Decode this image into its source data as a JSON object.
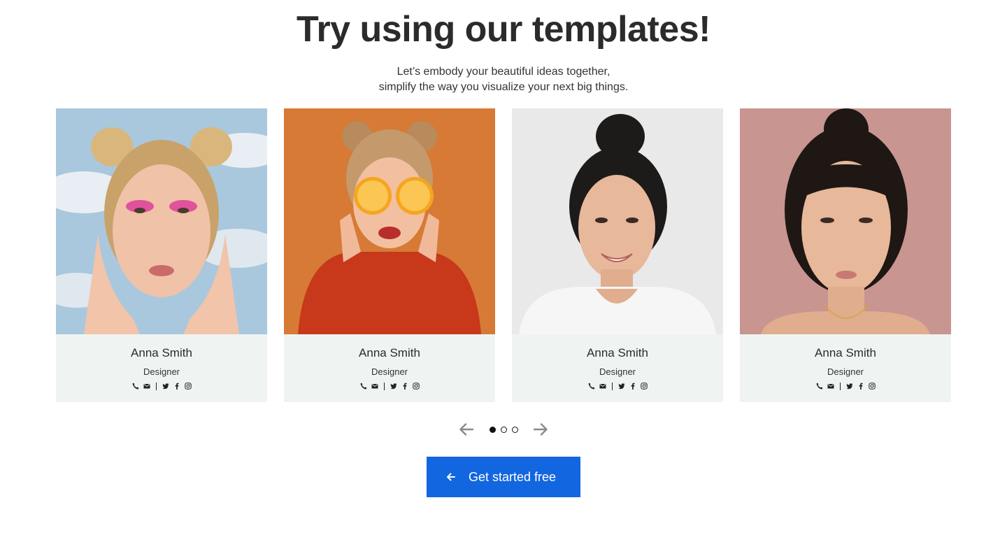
{
  "hero": {
    "title": "Try using our templates!",
    "subtitle_line1": "Let’s embody your beautiful ideas together,",
    "subtitle_line2": "simplify the way you visualize your next big things."
  },
  "cards": [
    {
      "name": "Anna Smith",
      "role": "Designer",
      "photo": "woman-pink-eyeshadow-sky-background",
      "bg": "#a9c8de"
    },
    {
      "name": "Anna Smith",
      "role": "Designer",
      "photo": "woman-orange-slices-orange-background",
      "bg": "#d77a36"
    },
    {
      "name": "Anna Smith",
      "role": "Designer",
      "photo": "woman-dark-bun-white-background",
      "bg": "#e9e9e9"
    },
    {
      "name": "Anna Smith",
      "role": "Designer",
      "photo": "woman-dark-hair-pink-background",
      "bg": "#c89590"
    }
  ],
  "social_icons": [
    "phone-icon",
    "mail-icon",
    "twitter-icon",
    "facebook-icon",
    "instagram-icon"
  ],
  "pager": {
    "prev_icon": "arrow-left-icon",
    "next_icon": "arrow-right-icon",
    "pages": 3,
    "active_page": 1
  },
  "cta": {
    "label": "Get started free",
    "icon": "arrow-left-icon",
    "color": "#1266e0"
  },
  "colors": {
    "card_bg": "#eff4f2",
    "text": "#2b2b2b",
    "arrow": "#8a8a8a"
  }
}
